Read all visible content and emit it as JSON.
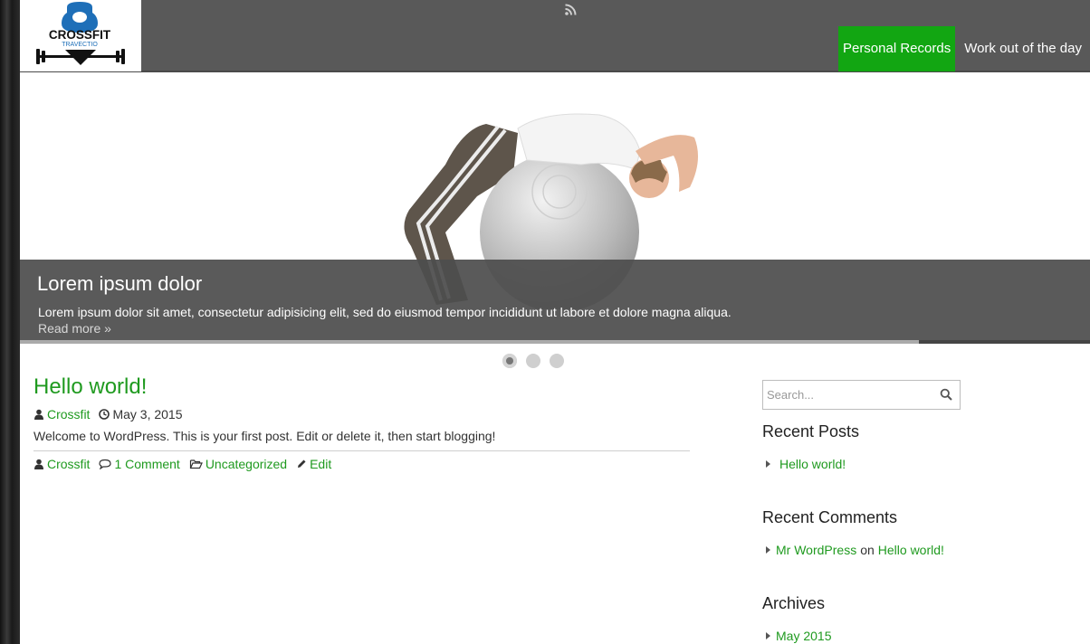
{
  "header": {
    "logo_text_top": "CROSSFIT",
    "logo_text_bottom": "TRAVECTIO",
    "rss": "rss-icon",
    "nav": [
      {
        "label": "Personal Records",
        "active": true
      },
      {
        "label": "Work out of the day",
        "active": false
      }
    ]
  },
  "slider": {
    "title": "Lorem ipsum dolor",
    "text": "Lorem ipsum dolor sit amet, consectetur adipisicing elit, sed do eiusmod tempor incididunt ut labore et dolore magna aliqua.",
    "read_more": "Read more »",
    "progress": 0.84,
    "slide_count": 3,
    "active_slide": 1
  },
  "post": {
    "title": "Hello world!",
    "author": "Crossfit",
    "date": "May 3, 2015",
    "body": "Welcome to WordPress. This is your first post. Edit or delete it, then start blogging!",
    "comments": "1 Comment",
    "category": "Uncategorized",
    "edit": "Edit"
  },
  "sidebar": {
    "search_placeholder": "Search...",
    "recent_posts_title": "Recent Posts",
    "recent_posts": [
      "Hello world!"
    ],
    "recent_comments_title": "Recent Comments",
    "recent_comment": {
      "author": "Mr WordPress",
      "on": "on",
      "post": "Hello world!"
    },
    "archives_title": "Archives",
    "archives": [
      "May 2015"
    ]
  },
  "colors": {
    "accent": "#1f9a1f",
    "nav_active": "#12a612",
    "header_bg": "#595959"
  }
}
